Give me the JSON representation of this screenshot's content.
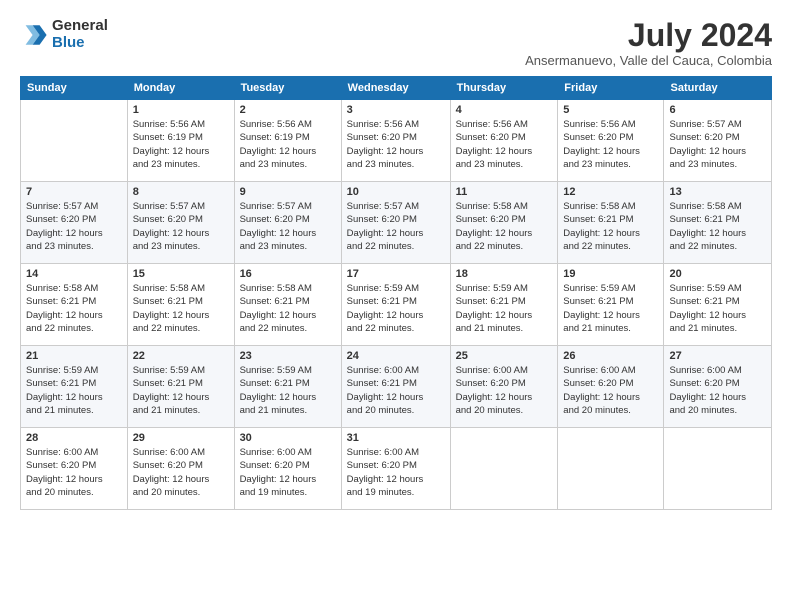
{
  "logo": {
    "general": "General",
    "blue": "Blue"
  },
  "title": {
    "month_year": "July 2024",
    "location": "Ansermanuevo, Valle del Cauca, Colombia"
  },
  "weekdays": [
    "Sunday",
    "Monday",
    "Tuesday",
    "Wednesday",
    "Thursday",
    "Friday",
    "Saturday"
  ],
  "weeks": [
    [
      {
        "day": "",
        "info": ""
      },
      {
        "day": "1",
        "info": "Sunrise: 5:56 AM\nSunset: 6:19 PM\nDaylight: 12 hours\nand 23 minutes."
      },
      {
        "day": "2",
        "info": "Sunrise: 5:56 AM\nSunset: 6:19 PM\nDaylight: 12 hours\nand 23 minutes."
      },
      {
        "day": "3",
        "info": "Sunrise: 5:56 AM\nSunset: 6:20 PM\nDaylight: 12 hours\nand 23 minutes."
      },
      {
        "day": "4",
        "info": "Sunrise: 5:56 AM\nSunset: 6:20 PM\nDaylight: 12 hours\nand 23 minutes."
      },
      {
        "day": "5",
        "info": "Sunrise: 5:56 AM\nSunset: 6:20 PM\nDaylight: 12 hours\nand 23 minutes."
      },
      {
        "day": "6",
        "info": "Sunrise: 5:57 AM\nSunset: 6:20 PM\nDaylight: 12 hours\nand 23 minutes."
      }
    ],
    [
      {
        "day": "7",
        "info": "Sunrise: 5:57 AM\nSunset: 6:20 PM\nDaylight: 12 hours\nand 23 minutes."
      },
      {
        "day": "8",
        "info": "Sunrise: 5:57 AM\nSunset: 6:20 PM\nDaylight: 12 hours\nand 23 minutes."
      },
      {
        "day": "9",
        "info": "Sunrise: 5:57 AM\nSunset: 6:20 PM\nDaylight: 12 hours\nand 23 minutes."
      },
      {
        "day": "10",
        "info": "Sunrise: 5:57 AM\nSunset: 6:20 PM\nDaylight: 12 hours\nand 22 minutes."
      },
      {
        "day": "11",
        "info": "Sunrise: 5:58 AM\nSunset: 6:20 PM\nDaylight: 12 hours\nand 22 minutes."
      },
      {
        "day": "12",
        "info": "Sunrise: 5:58 AM\nSunset: 6:21 PM\nDaylight: 12 hours\nand 22 minutes."
      },
      {
        "day": "13",
        "info": "Sunrise: 5:58 AM\nSunset: 6:21 PM\nDaylight: 12 hours\nand 22 minutes."
      }
    ],
    [
      {
        "day": "14",
        "info": "Sunrise: 5:58 AM\nSunset: 6:21 PM\nDaylight: 12 hours\nand 22 minutes."
      },
      {
        "day": "15",
        "info": "Sunrise: 5:58 AM\nSunset: 6:21 PM\nDaylight: 12 hours\nand 22 minutes."
      },
      {
        "day": "16",
        "info": "Sunrise: 5:58 AM\nSunset: 6:21 PM\nDaylight: 12 hours\nand 22 minutes."
      },
      {
        "day": "17",
        "info": "Sunrise: 5:59 AM\nSunset: 6:21 PM\nDaylight: 12 hours\nand 22 minutes."
      },
      {
        "day": "18",
        "info": "Sunrise: 5:59 AM\nSunset: 6:21 PM\nDaylight: 12 hours\nand 21 minutes."
      },
      {
        "day": "19",
        "info": "Sunrise: 5:59 AM\nSunset: 6:21 PM\nDaylight: 12 hours\nand 21 minutes."
      },
      {
        "day": "20",
        "info": "Sunrise: 5:59 AM\nSunset: 6:21 PM\nDaylight: 12 hours\nand 21 minutes."
      }
    ],
    [
      {
        "day": "21",
        "info": "Sunrise: 5:59 AM\nSunset: 6:21 PM\nDaylight: 12 hours\nand 21 minutes."
      },
      {
        "day": "22",
        "info": "Sunrise: 5:59 AM\nSunset: 6:21 PM\nDaylight: 12 hours\nand 21 minutes."
      },
      {
        "day": "23",
        "info": "Sunrise: 5:59 AM\nSunset: 6:21 PM\nDaylight: 12 hours\nand 21 minutes."
      },
      {
        "day": "24",
        "info": "Sunrise: 6:00 AM\nSunset: 6:21 PM\nDaylight: 12 hours\nand 20 minutes."
      },
      {
        "day": "25",
        "info": "Sunrise: 6:00 AM\nSunset: 6:20 PM\nDaylight: 12 hours\nand 20 minutes."
      },
      {
        "day": "26",
        "info": "Sunrise: 6:00 AM\nSunset: 6:20 PM\nDaylight: 12 hours\nand 20 minutes."
      },
      {
        "day": "27",
        "info": "Sunrise: 6:00 AM\nSunset: 6:20 PM\nDaylight: 12 hours\nand 20 minutes."
      }
    ],
    [
      {
        "day": "28",
        "info": "Sunrise: 6:00 AM\nSunset: 6:20 PM\nDaylight: 12 hours\nand 20 minutes."
      },
      {
        "day": "29",
        "info": "Sunrise: 6:00 AM\nSunset: 6:20 PM\nDaylight: 12 hours\nand 20 minutes."
      },
      {
        "day": "30",
        "info": "Sunrise: 6:00 AM\nSunset: 6:20 PM\nDaylight: 12 hours\nand 19 minutes."
      },
      {
        "day": "31",
        "info": "Sunrise: 6:00 AM\nSunset: 6:20 PM\nDaylight: 12 hours\nand 19 minutes."
      },
      {
        "day": "",
        "info": ""
      },
      {
        "day": "",
        "info": ""
      },
      {
        "day": "",
        "info": ""
      }
    ]
  ]
}
